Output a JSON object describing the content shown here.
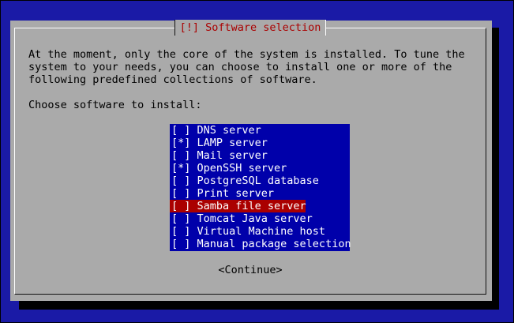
{
  "dialog": {
    "title": "[!] Software selection",
    "intro": "At the moment, only the core of the system is installed. To tune the\nsystem to your needs, you can choose to install one or more of the\nfollowing predefined collections of software.",
    "prompt": "Choose software to install:",
    "continue_label": "<Continue>"
  },
  "software": [
    {
      "label": "[ ] DNS server"
    },
    {
      "label": "[*] LAMP server"
    },
    {
      "label": "[ ] Mail server"
    },
    {
      "label": "[*] OpenSSH server"
    },
    {
      "label": "[ ] PostgreSQL database"
    },
    {
      "label": "[ ] Print server"
    },
    {
      "label": "[ ] Samba file server"
    },
    {
      "label": "[ ] Tomcat Java server"
    },
    {
      "label": "[ ] Virtual Machine host"
    },
    {
      "label": "[ ] Manual package selection"
    }
  ],
  "colors": {
    "background": "#1a1aa6",
    "dialog": "#aaaaaa",
    "list": "#0000aa",
    "highlight": "#aa0000",
    "title": "#aa0000"
  }
}
